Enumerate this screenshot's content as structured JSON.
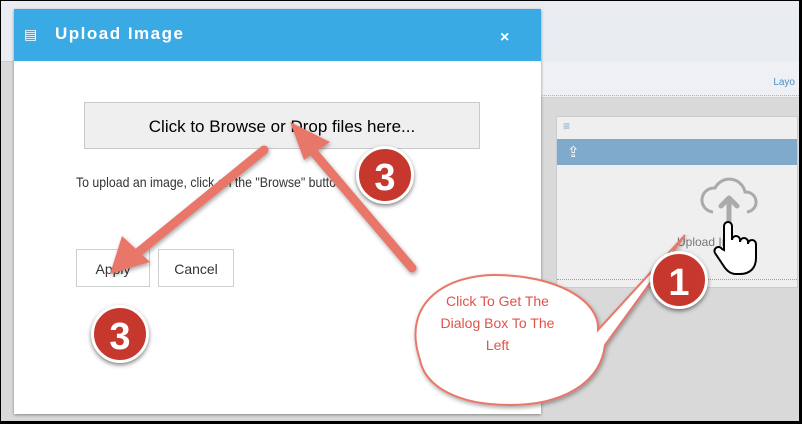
{
  "dialog": {
    "title": "Upload Image",
    "title_icon": "document-icon",
    "close_label": "×",
    "browse_label": "Click to Browse or Drop files here...",
    "hint_text": "To upload an image, click on the \"Browse\" button.",
    "apply_label": "Apply",
    "cancel_label": "Cancel",
    "resize_glyph": "⠿"
  },
  "background": {
    "layout_label": "Layo",
    "upload_label": "Upload Image",
    "panel_handle_glyph": "≡",
    "panel_icon_glyph": "⇪"
  },
  "annotations": {
    "badge_top": "3",
    "badge_bottom": "3",
    "badge_right": "1",
    "callout_text": "Click To Get The Dialog Box To The Left",
    "colors": {
      "arrow": "#e8776b",
      "badge": "#c6382e",
      "callout_text": "#e0534a"
    }
  },
  "colors": {
    "header": "#3aaae4",
    "panel_bar": "#7faacc"
  }
}
